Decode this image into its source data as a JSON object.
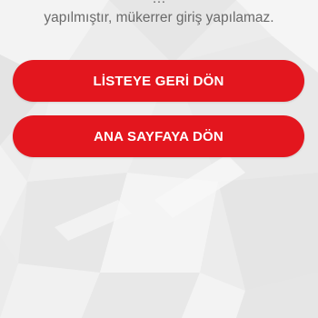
{
  "message": {
    "line1": "... yapılmıştır, mükerrer giriş yapılamaz.",
    "line1_partial_top": "…",
    "line2": "yapılmıştır, mükerrer giriş yapılamaz."
  },
  "buttons": {
    "back_to_list": "LİSTEYE GERİ DÖN",
    "back_to_home": "ANA SAYFAYA DÖN"
  },
  "colors": {
    "accent": "#e3161e",
    "background": "#ececec",
    "text_muted": "#6a6a6a"
  }
}
